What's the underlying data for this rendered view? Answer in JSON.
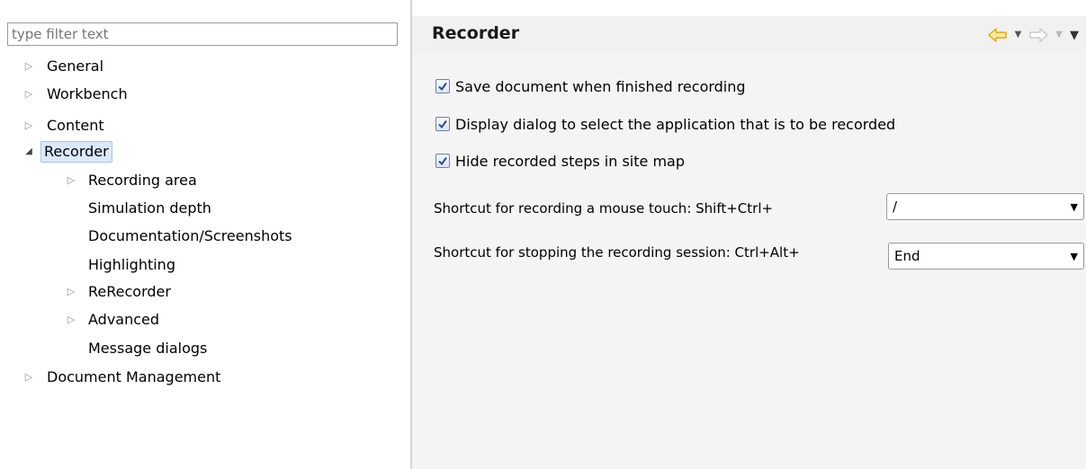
{
  "filter": {
    "placeholder": "type filter text"
  },
  "tree": {
    "items": [
      {
        "label": "General",
        "expander": "▷"
      },
      {
        "label": "Workbench",
        "expander": "▷"
      },
      {
        "label": "Content",
        "expander": "▷"
      },
      {
        "label": "Recorder",
        "expander": "◢"
      },
      {
        "label": "Recording area",
        "expander": "▷"
      },
      {
        "label": "Simulation depth"
      },
      {
        "label": "Documentation/Screenshots"
      },
      {
        "label": "Highlighting"
      },
      {
        "label": "ReRecorder",
        "expander": "▷"
      },
      {
        "label": "Advanced",
        "expander": "▷"
      },
      {
        "label": "Message dialogs"
      },
      {
        "label": "Document Management",
        "expander": "▷"
      }
    ]
  },
  "page": {
    "title": "Recorder",
    "nav": {
      "back_icon": "back-arrow-icon",
      "forward_icon": "forward-arrow-icon",
      "accent": "#f0b400"
    },
    "options": [
      {
        "label": "Save document when finished recording",
        "checked": true
      },
      {
        "label": "Display dialog to select the application that is to be recorded",
        "checked": true
      },
      {
        "label": "Hide recorded steps in site map",
        "checked": true
      }
    ],
    "shortcuts": [
      {
        "label": "Shortcut for recording a mouse touch: Shift+Ctrl+",
        "value": "/"
      },
      {
        "label": "Shortcut for stopping the recording session: Ctrl+Alt+",
        "value": "End"
      }
    ]
  }
}
